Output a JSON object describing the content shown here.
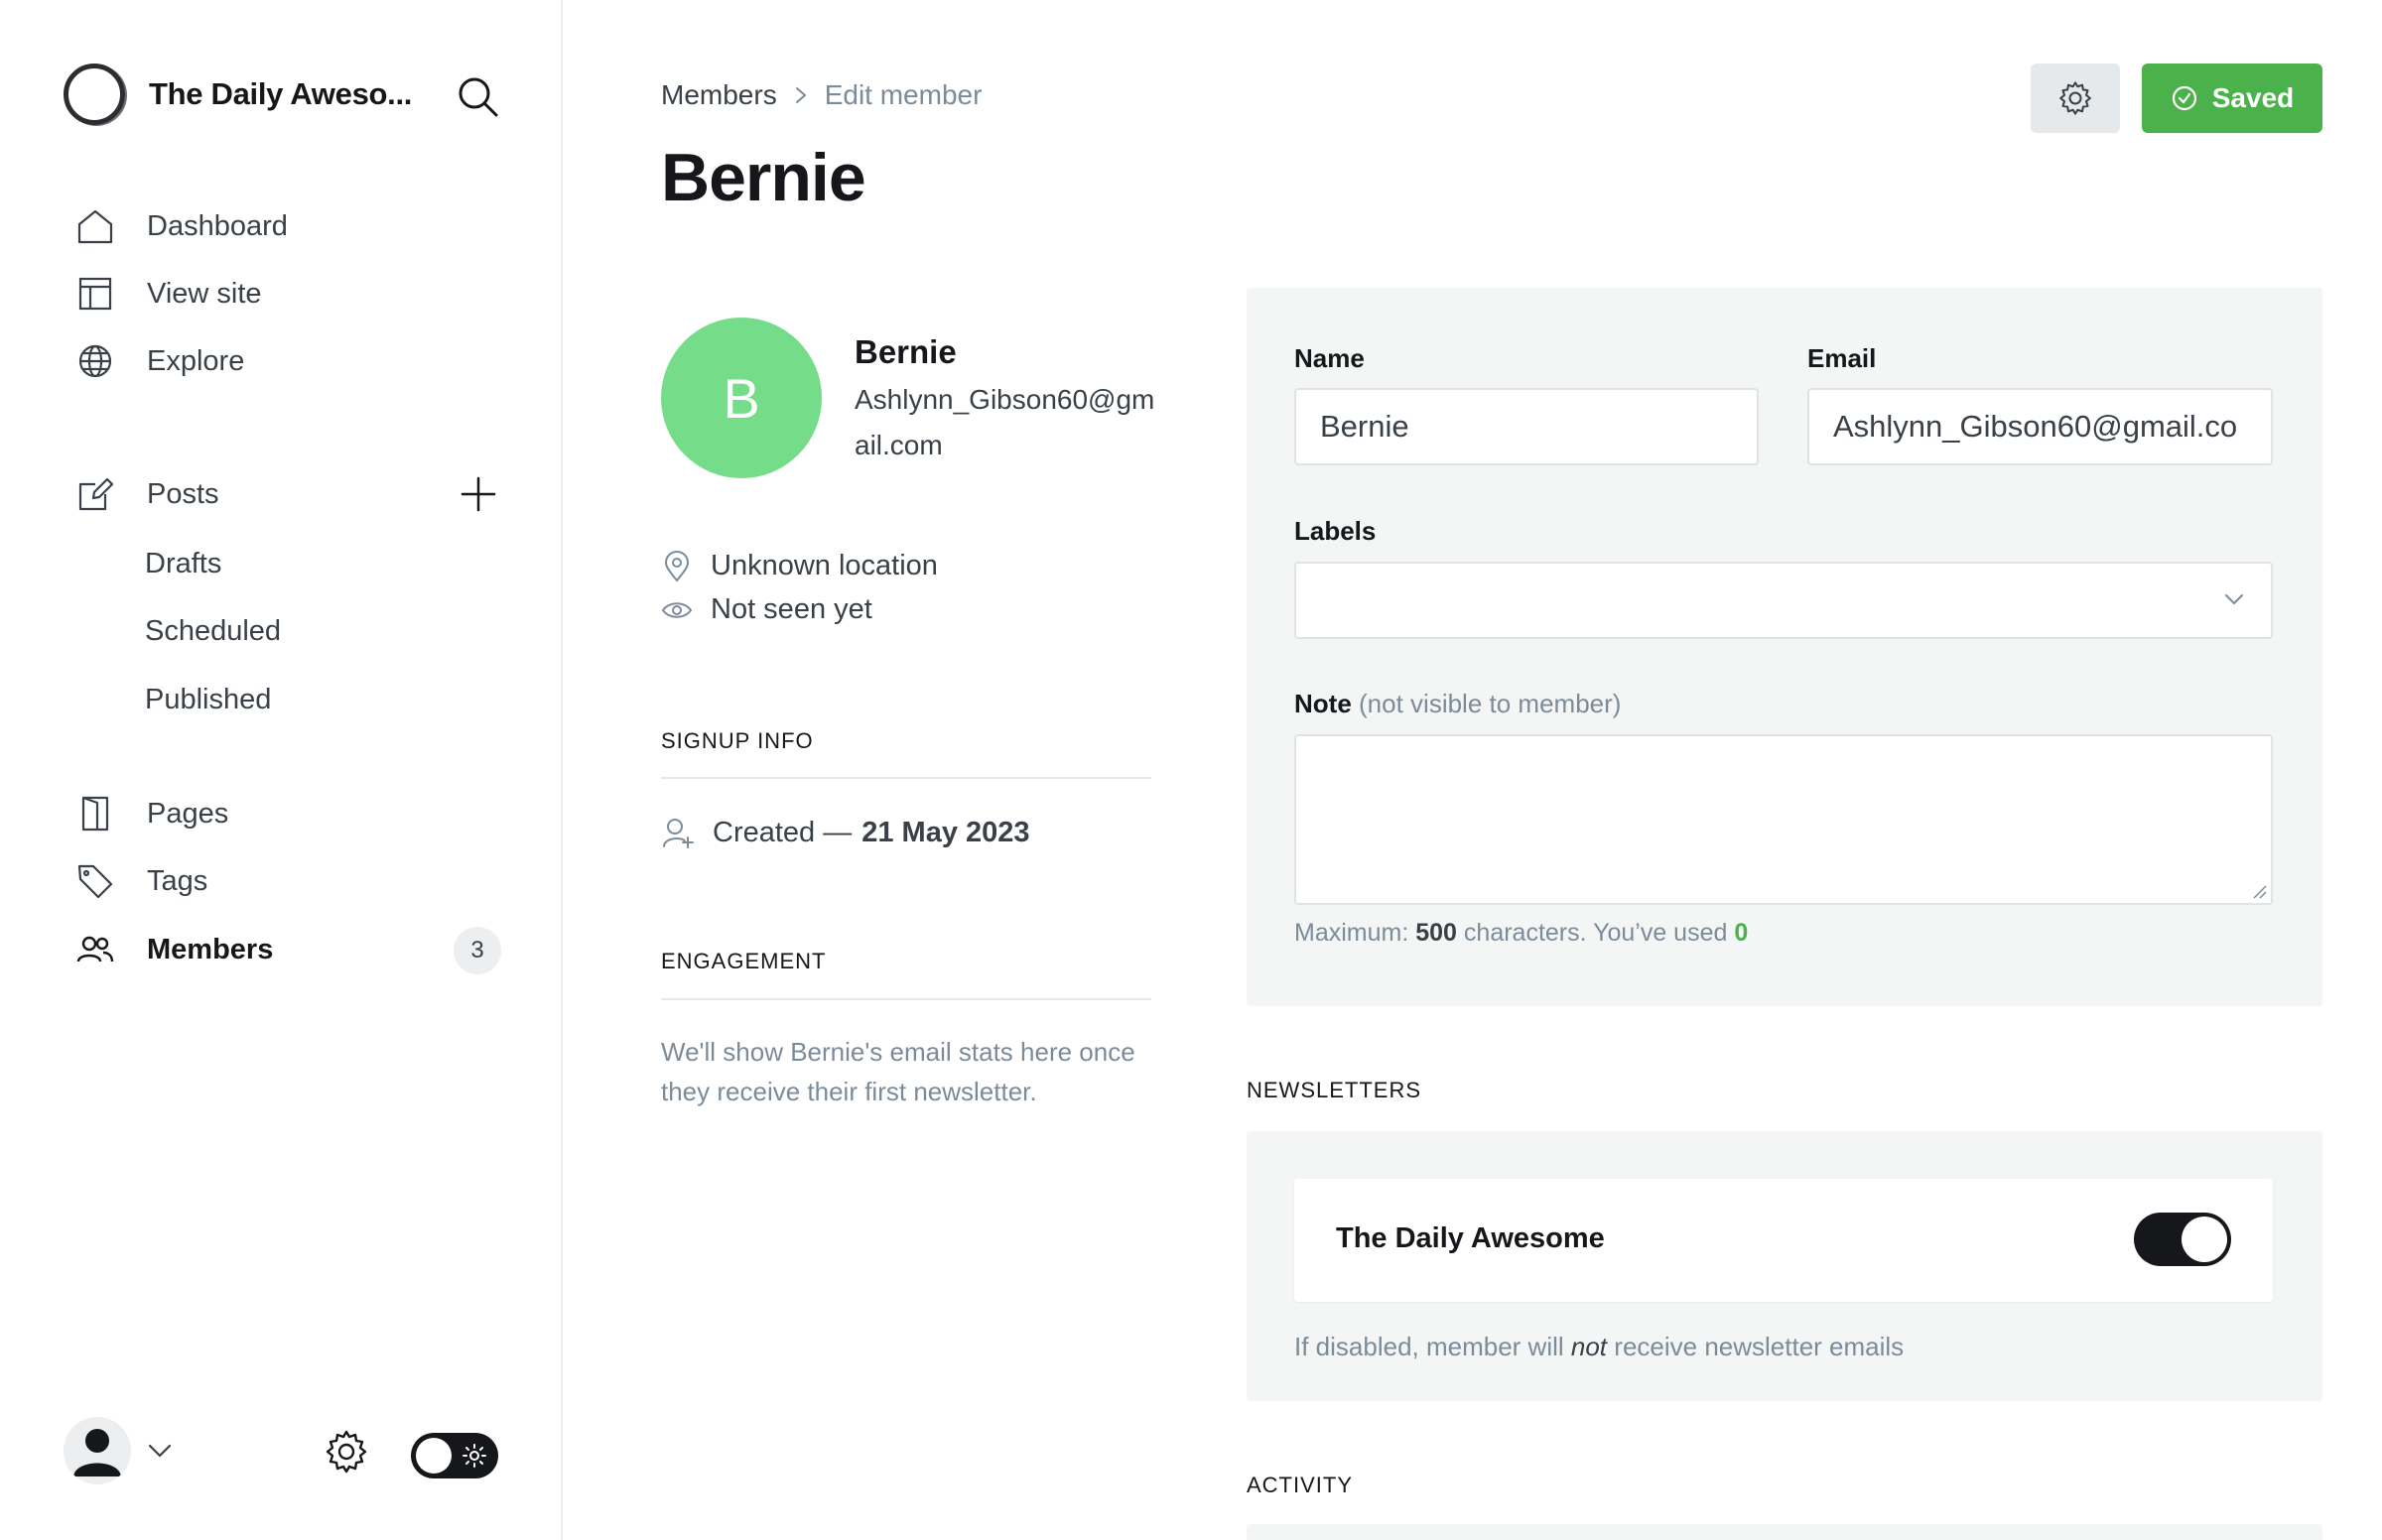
{
  "brand": {
    "title": "The Daily Aweso..."
  },
  "nav": {
    "dashboard": "Dashboard",
    "view_site": "View site",
    "explore": "Explore",
    "posts": "Posts",
    "drafts": "Drafts",
    "scheduled": "Scheduled",
    "published": "Published",
    "pages": "Pages",
    "tags": "Tags",
    "members": "Members",
    "members_count": "3"
  },
  "breadcrumb": {
    "parent": "Members",
    "current": "Edit member"
  },
  "page": {
    "title": "Bernie"
  },
  "toolbar": {
    "saved_label": "Saved"
  },
  "member": {
    "initial": "B",
    "name": "Bernie",
    "email": "Ashlynn_Gibson60@gmail.com",
    "location": "Unknown location",
    "last_seen": "Not seen yet",
    "avatar_color": "#75dc8a"
  },
  "signup": {
    "section_label": "SIGNUP INFO",
    "created_prefix": "Created —",
    "created_date": "21 May 2023"
  },
  "engagement": {
    "section_label": "ENGAGEMENT",
    "text": "We'll show Bernie's email stats here once they receive their first newsletter."
  },
  "form": {
    "name_label": "Name",
    "name_value": "Bernie",
    "email_label": "Email",
    "email_value": "Ashlynn_Gibson60@gmail.co",
    "labels_label": "Labels",
    "note_label": "Note",
    "note_hint": "(not visible to member)",
    "char_prefix": "Maximum:",
    "char_max": "500",
    "char_mid": "characters. You’ve used",
    "char_used": "0"
  },
  "newsletters": {
    "section_label": "NEWSLETTERS",
    "items": [
      {
        "name": "The Daily Awesome",
        "enabled": true
      }
    ],
    "hint_prefix": "If disabled, member will",
    "hint_emph": "not",
    "hint_suffix": "receive newsletter emails"
  },
  "activity": {
    "section_label": "ACTIVITY"
  },
  "colors": {
    "accent_green": "#4bb24b",
    "text_dark": "#15171a",
    "muted": "#7c8b9a",
    "panel_bg": "#f4f5f5"
  }
}
